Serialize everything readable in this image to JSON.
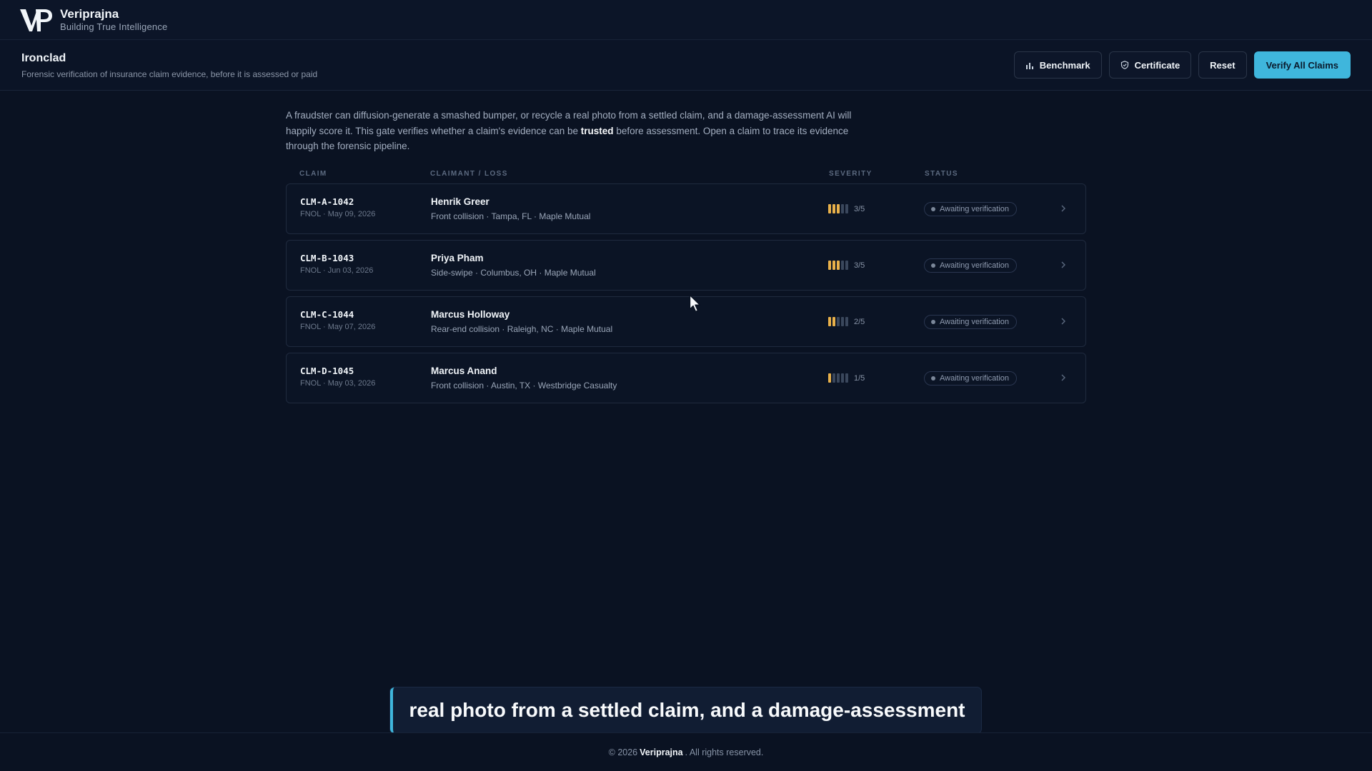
{
  "brand": {
    "name": "Veriprajna",
    "tagline": "Building True Intelligence"
  },
  "header": {
    "title": "Ironclad",
    "subtitle": "Forensic verification of insurance claim evidence, before it is assessed or paid",
    "buttons": {
      "benchmark": "Benchmark",
      "certificate": "Certificate",
      "reset": "Reset",
      "verify_all": "Verify All Claims"
    }
  },
  "intro": {
    "before": "A fraudster can diffusion-generate a smashed bumper, or recycle a real photo from a settled claim, and a damage-assessment AI will happily score it. This gate verifies whether a claim's evidence can be ",
    "bold": "trusted",
    "after": " before assessment. Open a claim to trace its evidence through the forensic pipeline."
  },
  "table": {
    "columns": {
      "claim": "CLAIM",
      "claimant": "CLAIMANT / LOSS",
      "severity": "SEVERITY",
      "status": "STATUS"
    },
    "rows": [
      {
        "id": "CLM-A-1042",
        "date": "FNOL · May 09, 2026",
        "name": "Henrik Greer",
        "loss": "Front collision · Tampa, FL · Maple Mutual",
        "severity": 3,
        "severity_label": "3/5",
        "status": "Awaiting verification"
      },
      {
        "id": "CLM-B-1043",
        "date": "FNOL · Jun 03, 2026",
        "name": "Priya Pham",
        "loss": "Side-swipe · Columbus, OH · Maple Mutual",
        "severity": 3,
        "severity_label": "3/5",
        "status": "Awaiting verification"
      },
      {
        "id": "CLM-C-1044",
        "date": "FNOL · May 07, 2026",
        "name": "Marcus Holloway",
        "loss": "Rear-end collision · Raleigh, NC · Maple Mutual",
        "severity": 2,
        "severity_label": "2/5",
        "status": "Awaiting verification"
      },
      {
        "id": "CLM-D-1045",
        "date": "FNOL · May 03, 2026",
        "name": "Marcus Anand",
        "loss": "Front collision · Austin, TX · Westbridge Casualty",
        "severity": 1,
        "severity_label": "1/5",
        "status": "Awaiting verification"
      }
    ]
  },
  "caption": "real photo from a settled claim, and a damage-assessment",
  "footer": {
    "prefix": "© 2026",
    "brand": "Veriprajna",
    "suffix": ". All rights reserved."
  },
  "colors": {
    "accent": "#3fb6dc",
    "severity_on": "#e9b14a",
    "severity_off": "#3a475c",
    "background": "#0a1222"
  },
  "icons": {
    "logo": "vp-logo",
    "benchmark": "bar-chart-icon",
    "certificate": "shield-icon",
    "row_open": "chevron-right-icon",
    "cursor": "mouse-pointer-icon"
  }
}
